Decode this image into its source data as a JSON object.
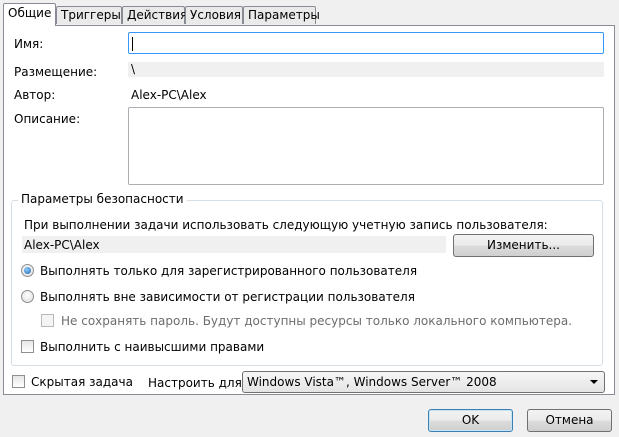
{
  "tabs": [
    {
      "label": "Общие"
    },
    {
      "label": "Триггеры"
    },
    {
      "label": "Действия"
    },
    {
      "label": "Условия"
    },
    {
      "label": "Параметры"
    }
  ],
  "general": {
    "name_label": "Имя:",
    "name_value": "",
    "location_label": "Размещение:",
    "location_value": "\\",
    "author_label": "Автор:",
    "author_value": "Alex-PC\\Alex",
    "description_label": "Описание:",
    "description_value": ""
  },
  "security": {
    "title": "Параметры безопасности",
    "account_prompt": "При выполнении задачи использовать следующую учетную запись пользователя:",
    "account_value": "Alex-PC\\Alex",
    "change_button": "Изменить...",
    "radio_logged_on": "Выполнять только для зарегистрированного пользователя",
    "radio_any": "Выполнять вне зависимости от регистрации пользователя",
    "checkbox_no_password": "Не сохранять пароль. Будут доступны ресурсы только локального компьютера.",
    "checkbox_highest": "Выполнить с наивысшими правами"
  },
  "footer": {
    "hidden_task": "Скрытая задача",
    "configure_for_label": "Настроить для:",
    "configure_for_value": "Windows Vista™, Windows Server™ 2008"
  },
  "buttons": {
    "ok": "OK",
    "cancel": "Отмена"
  },
  "colors": {
    "focus_border": "#3399ff",
    "default_button_border": "#3c7fb1"
  }
}
